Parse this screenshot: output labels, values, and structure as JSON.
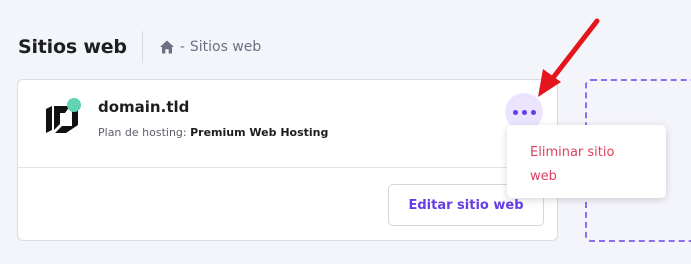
{
  "header": {
    "title": "Sitios web",
    "breadcrumb": {
      "separator": "-",
      "current": "Sitios web",
      "home_icon": "home-icon"
    }
  },
  "site_card": {
    "domain": "domain.tld",
    "plan_label": "Plan de hosting:",
    "plan_value": "Premium Web Hosting",
    "edit_button": "Editar sitio web",
    "more_icon": "more-horizontal-icon",
    "logo_icon": "hostinger-logo-icon",
    "status_color": "#5fd3b3"
  },
  "dropdown": {
    "items": [
      {
        "label": "Eliminar sitio web",
        "color": "#e0405e"
      }
    ]
  },
  "colors": {
    "accent": "#673de6",
    "arrow": "#e4151c",
    "background": "#f4f5fb"
  }
}
